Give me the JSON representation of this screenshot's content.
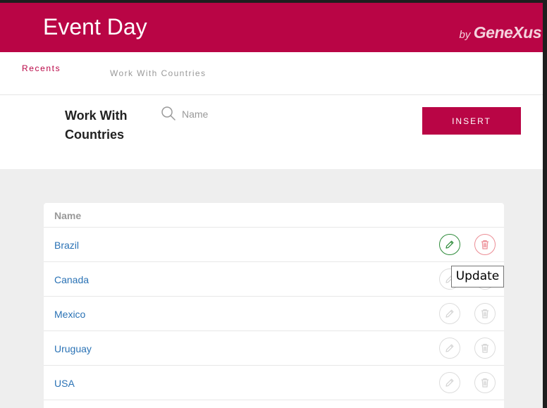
{
  "header": {
    "title": "Event Day",
    "brand_by": "by",
    "brand_name": "GeneXus",
    "color": "#b90545"
  },
  "breadcrumbs": {
    "recent": "Recents",
    "current": "Work With Countries"
  },
  "toolbar": {
    "page_title": "Work With Countries",
    "search_placeholder": "Name",
    "search_value": "",
    "insert_label": "INSERT"
  },
  "grid": {
    "column_header": "Name",
    "rows": [
      {
        "name": "Brazil",
        "hovered": true
      },
      {
        "name": "Canada",
        "hovered": false
      },
      {
        "name": "Mexico",
        "hovered": false
      },
      {
        "name": "Uruguay",
        "hovered": false
      },
      {
        "name": "USA",
        "hovered": false
      }
    ],
    "row_actions": [
      "pencil-icon",
      "trash-icon"
    ]
  },
  "tooltip": {
    "text": "Update"
  },
  "colors": {
    "accent": "#b90545",
    "link": "#2a72b5",
    "edit_active": "#2e8b3a",
    "delete_active": "#ec8d95"
  }
}
